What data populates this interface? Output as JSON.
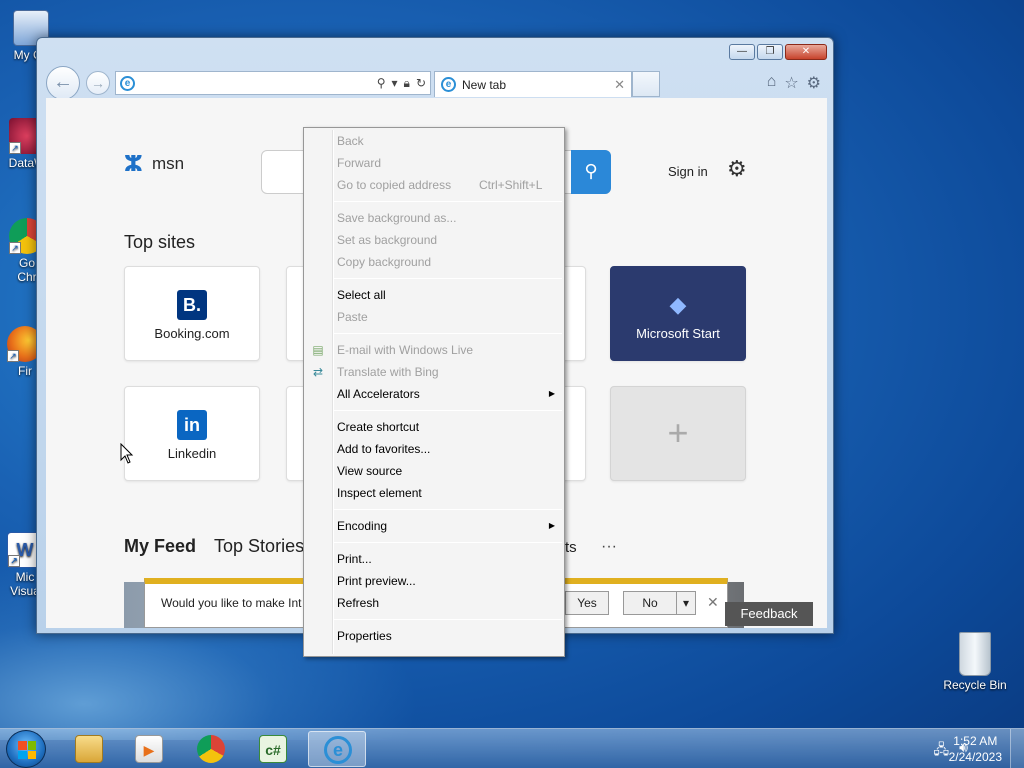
{
  "desktop": {
    "icons": [
      {
        "label": "My Co",
        "color": "#3c78c8"
      },
      {
        "label": "DataW",
        "color": "#b02040"
      },
      {
        "label": "Go\nChr",
        "color": "#2a9a3a"
      },
      {
        "label": "Fir",
        "color": "#e8701a"
      },
      {
        "label": "Mic\nVisua",
        "color": "#2a5aa8"
      }
    ],
    "recycle_bin": "Recycle Bin"
  },
  "browser": {
    "address_value": "",
    "tab_title": "New tab",
    "nav_back": "←",
    "nav_forward": "→",
    "window_controls": [
      "—",
      "❐",
      "✕"
    ]
  },
  "page": {
    "logo_text": "msn",
    "sign_in": "Sign in",
    "top_sites_label": "Top sites",
    "tiles": [
      {
        "name": "Booking.com",
        "logo": "B.",
        "color": "#003580"
      },
      {
        "name": "Microsoft Start",
        "logo": "◆",
        "color": "#2b3a6e"
      },
      {
        "name": "Linkedin",
        "logo": "in",
        "color": "#0a66c2"
      },
      {
        "name": "",
        "logo": "+"
      }
    ],
    "feed_tabs": [
      "My Feed",
      "Top Stories"
    ],
    "feed_more": "ts",
    "feed_dots": "···",
    "notification": {
      "text": "Would you like to make Int",
      "yes": "Yes",
      "no": "No",
      "dropdown": "▾",
      "close": "✕"
    },
    "feedback": "Feedback"
  },
  "context_menu": {
    "items": [
      {
        "label": "Back",
        "disabled": true
      },
      {
        "label": "Forward",
        "disabled": true
      },
      {
        "label": "Go to copied address",
        "shortcut": "Ctrl+Shift+L",
        "disabled": true
      },
      {
        "label": "Save background as...",
        "disabled": true
      },
      {
        "label": "Set as background",
        "disabled": true
      },
      {
        "label": "Copy background",
        "disabled": true
      },
      {
        "label": "Select all",
        "disabled": false
      },
      {
        "label": "Paste",
        "disabled": true
      },
      {
        "label": "E-mail with Windows Live",
        "disabled": true
      },
      {
        "label": "Translate with Bing",
        "disabled": true
      },
      {
        "label": "All Accelerators",
        "disabled": false,
        "submenu": true
      },
      {
        "label": "Create shortcut",
        "disabled": false
      },
      {
        "label": "Add to favorites...",
        "disabled": false
      },
      {
        "label": "View source",
        "disabled": false
      },
      {
        "label": "Inspect element",
        "disabled": false
      },
      {
        "label": "Encoding",
        "disabled": false,
        "submenu": true
      },
      {
        "label": "Print...",
        "disabled": false
      },
      {
        "label": "Print preview...",
        "disabled": false
      },
      {
        "label": "Refresh",
        "disabled": false
      },
      {
        "label": "Properties",
        "disabled": false
      }
    ]
  },
  "taskbar": {
    "time": "1:52 AM",
    "date": "2/24/2023"
  }
}
